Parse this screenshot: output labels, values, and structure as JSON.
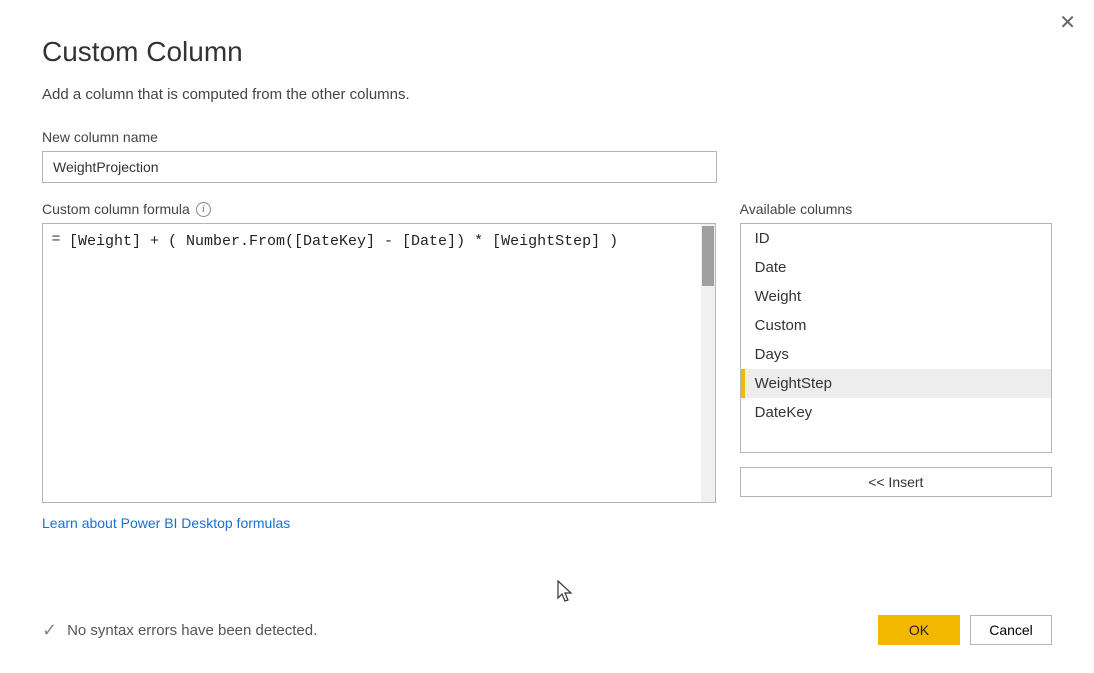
{
  "dialog": {
    "title": "Custom Column",
    "subtitle": "Add a column that is computed from the other columns."
  },
  "nameField": {
    "label": "New column name",
    "value": "WeightProjection"
  },
  "formulaField": {
    "label": "Custom column formula",
    "equals": "=",
    "value": "[Weight] + ( Number.From([DateKey] - [Date]) * [WeightStep] )"
  },
  "availableColumns": {
    "label": "Available columns",
    "items": [
      "ID",
      "Date",
      "Weight",
      "Custom",
      "Days",
      "WeightStep",
      "DateKey"
    ],
    "selectedIndex": 5,
    "insertLabel": "<< Insert"
  },
  "learnLink": {
    "text": "Learn about Power BI Desktop formulas"
  },
  "status": {
    "message": "No syntax errors have been detected."
  },
  "buttons": {
    "ok": "OK",
    "cancel": "Cancel"
  }
}
